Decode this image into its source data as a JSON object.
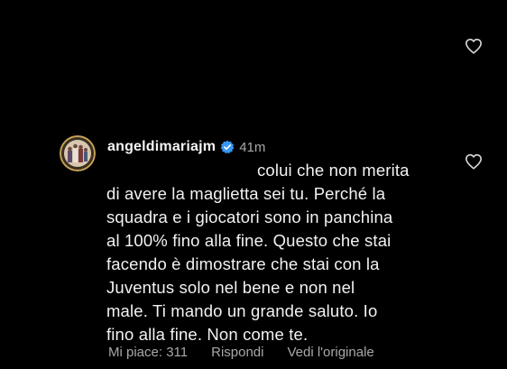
{
  "comment": {
    "username": "angeldimariajm",
    "verified": true,
    "timestamp": "41m",
    "lines": [
      "colui che non merita",
      "di avere la maglietta sei tu. Perché la",
      "squadra e i giocatori sono in panchina",
      "al 100% fino alla fine. Questo che stai",
      "facendo è dimostrare che stai con la",
      "Juventus solo nel bene e non nel",
      "male. Ti mando un grande saluto. Io",
      "fino alla fine. Non come te."
    ],
    "footer": {
      "likes": "Mi piace: 311",
      "reply": "Rispondi",
      "see_original": "Vedi l'originale"
    }
  },
  "icons": {
    "like": "heart-outline-icon",
    "verified": "verified-badge-icon"
  },
  "colors": {
    "background": "#000000",
    "text": "#f2f2f2",
    "secondary_text": "#a8a8a8",
    "verified_blue": "#3897f0"
  }
}
